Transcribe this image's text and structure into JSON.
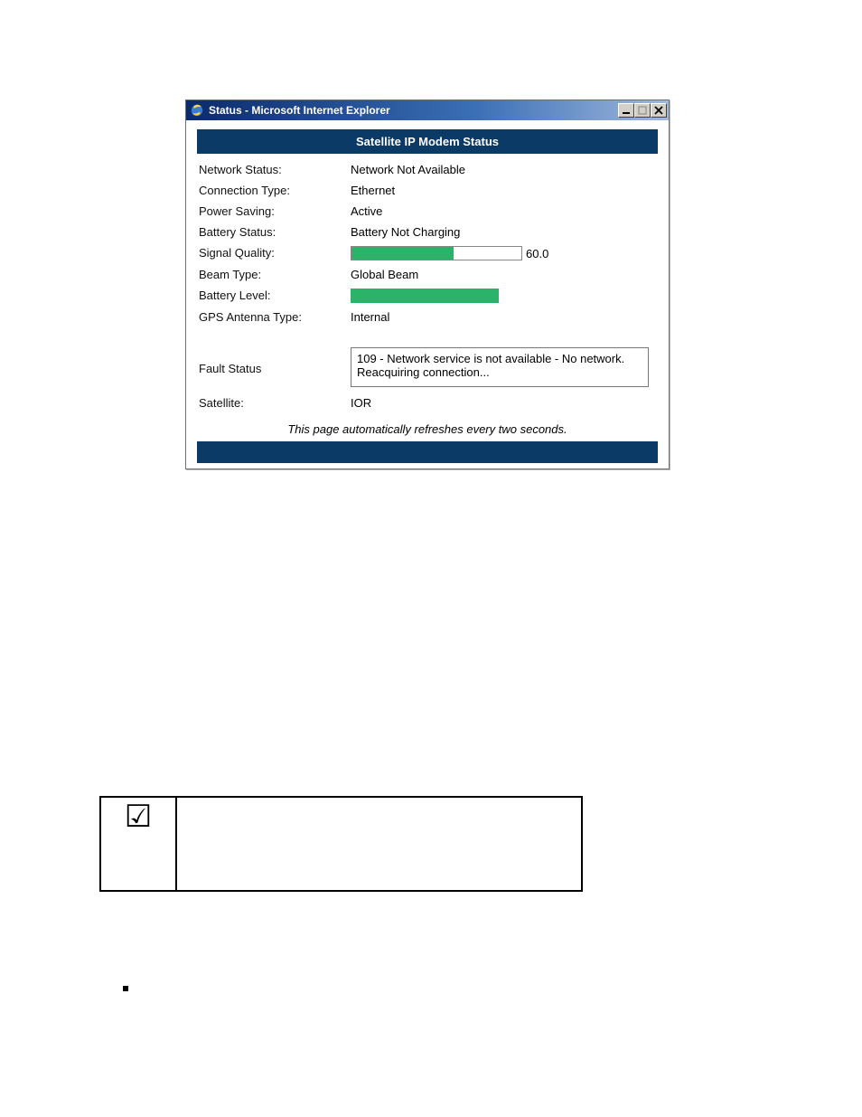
{
  "window": {
    "title": "Status - Microsoft Internet Explorer"
  },
  "panel": {
    "heading": "Satellite IP Modem Status"
  },
  "status": {
    "network_status_label": "Network Status:",
    "network_status_value": "Network Not Available",
    "connection_type_label": "Connection Type:",
    "connection_type_value": "Ethernet",
    "power_saving_label": "Power Saving:",
    "power_saving_value": "Active",
    "battery_status_label": "Battery Status:",
    "battery_status_value": "Battery Not Charging",
    "signal_quality_label": "Signal Quality:",
    "signal_quality_value": "60.0",
    "signal_quality_percent": 60,
    "beam_type_label": "Beam Type:",
    "beam_type_value": "Global Beam",
    "battery_level_label": "Battery Level:",
    "battery_level_percent": 100,
    "gps_antenna_type_label": "GPS Antenna Type:",
    "gps_antenna_type_value": "Internal",
    "fault_status_label": "Fault Status",
    "fault_status_value": "109 - Network service is not available - No network. Reacquiring connection...",
    "satellite_label": "Satellite:",
    "satellite_value": "IOR"
  },
  "footer": {
    "refresh_note": "This page automatically refreshes every two seconds."
  },
  "note_box": {
    "check_symbol": "☑",
    "text": ""
  }
}
